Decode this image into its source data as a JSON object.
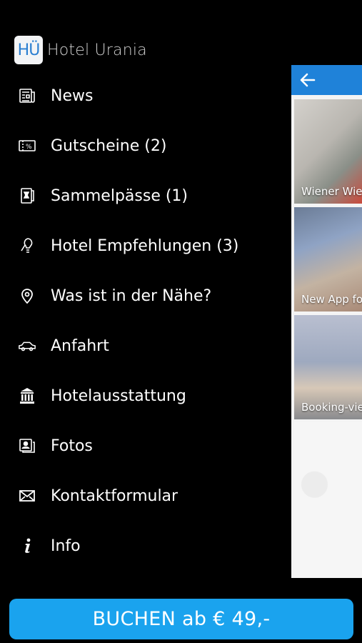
{
  "brand": {
    "logo_text": "HÜ",
    "title": "Hotel Urania"
  },
  "menu": {
    "items": [
      {
        "label": "News",
        "icon": "newspaper-icon"
      },
      {
        "label": "Gutscheine (2)",
        "icon": "voucher-icon"
      },
      {
        "label": "Sammelpässe (1)",
        "icon": "stamp-card-icon"
      },
      {
        "label": "Hotel Empfehlungen (3)",
        "icon": "recommendation-icon"
      },
      {
        "label": "Was ist in der Nähe?",
        "icon": "map-pin-icon"
      },
      {
        "label": "Anfahrt",
        "icon": "car-icon"
      },
      {
        "label": "Hotelausstattung",
        "icon": "building-icon"
      },
      {
        "label": "Fotos",
        "icon": "photos-icon"
      },
      {
        "label": "Kontaktformular",
        "icon": "envelope-icon"
      },
      {
        "label": "Info",
        "icon": "info-icon"
      }
    ]
  },
  "panel": {
    "cards": [
      {
        "caption": "Wiener Wie"
      },
      {
        "caption": "New App fo"
      },
      {
        "caption": "Booking-vie"
      }
    ]
  },
  "cta": {
    "label": "BUCHEN ab € 49,-"
  },
  "colors": {
    "accent": "#1aa3ee",
    "panel_bar": "#1f82d9",
    "background": "#000000"
  }
}
